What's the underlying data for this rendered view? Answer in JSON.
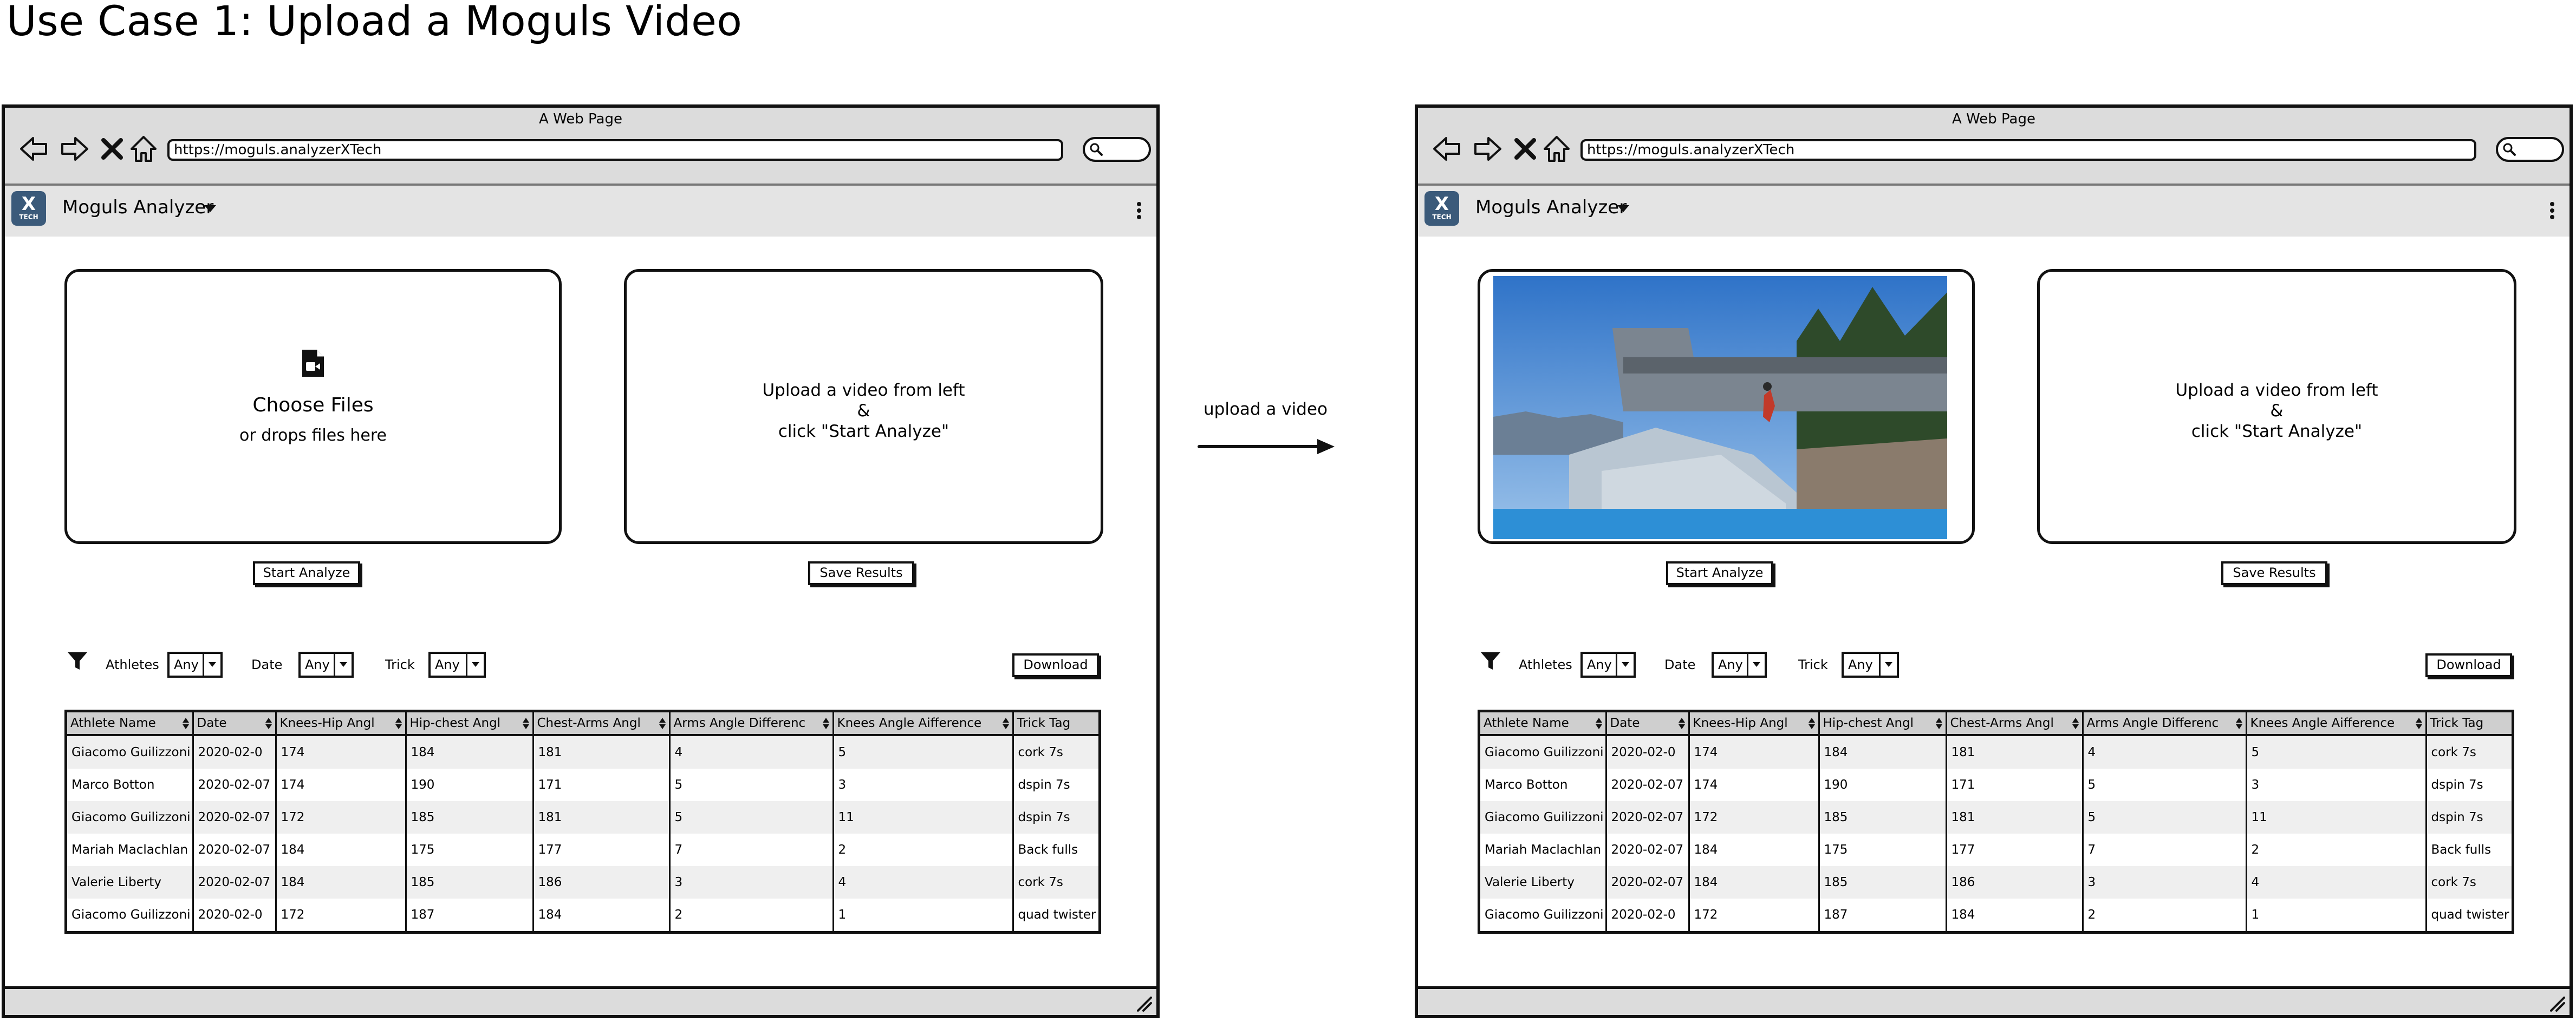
{
  "page_title": "Use Case 1: Upload a Moguls Video",
  "connector_label": "upload a video",
  "browser": {
    "window_title": "A Web Page",
    "url": "https://moguls.analyzerXTech",
    "nav_icons": [
      "back-arrow-icon",
      "forward-arrow-icon",
      "close-icon",
      "home-icon"
    ]
  },
  "app": {
    "logo_text": "X",
    "logo_subtext": "TECH",
    "name": "Moguls Analyzer",
    "logo_color": "#3b5a7a"
  },
  "upload": {
    "choose_label": "Choose Files",
    "drop_label": "or drops files here"
  },
  "result_panel": {
    "line1": "Upload a video from left",
    "line2": "&",
    "line3": "click \"Start Analyze\""
  },
  "buttons": {
    "start": "Start Analyze",
    "save": "Save Results",
    "download": "Download"
  },
  "filters": {
    "athletes_label": "Athletes",
    "athletes_value": "Any",
    "date_label": "Date",
    "date_value": "Any",
    "trick_label": "Trick",
    "trick_value": "Any"
  },
  "table": {
    "columns": [
      "Athlete Name",
      "Date",
      "Knees-Hip Angl",
      "Hip-chest Angl",
      "Chest-Arms Angl",
      "Arms Angle Differenc",
      "Knees Angle Aifference",
      "Trick Tag"
    ],
    "rows": [
      [
        "Giacomo Guilizzoni",
        "2020-02-0",
        "174",
        "184",
        "181",
        "4",
        "5",
        "cork 7s"
      ],
      [
        "Marco Botton",
        "2020-02-07",
        "174",
        "190",
        "171",
        "5",
        "3",
        "dspin 7s"
      ],
      [
        "Giacomo Guilizzoni",
        "2020-02-07",
        "172",
        "185",
        "181",
        "5",
        "11",
        "dspin 7s"
      ],
      [
        "Mariah Maclachlan",
        "2020-02-07",
        "184",
        "175",
        "177",
        "7",
        "2",
        "Back fulls"
      ],
      [
        "Valerie Liberty",
        "2020-02-07",
        "184",
        "185",
        "186",
        "3",
        "4",
        "cork 7s"
      ],
      [
        "Giacomo Guilizzoni",
        "2020-02-0",
        "172",
        "187",
        "184",
        "2",
        "1",
        "quad twister"
      ]
    ]
  }
}
